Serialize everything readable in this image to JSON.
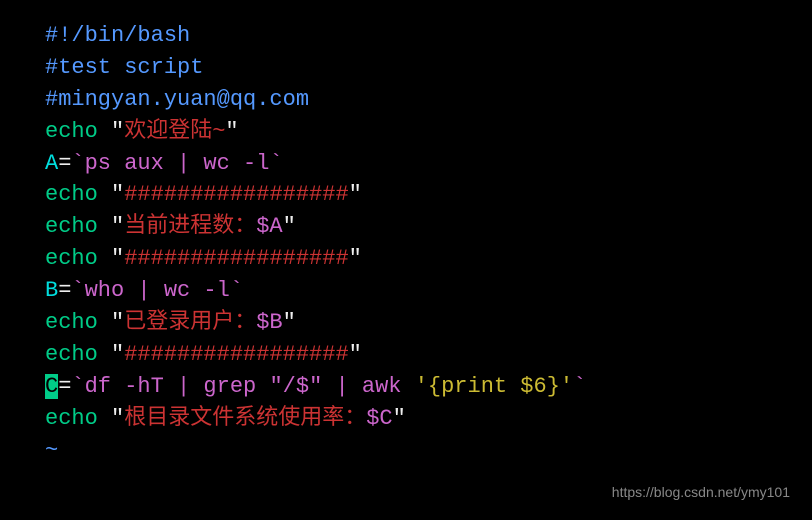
{
  "lines": {
    "l1": "#!/bin/bash",
    "l2": "#test script",
    "l3": "#mingyan.yuan@qq.com",
    "l4_echo": "echo",
    "l4_quote1": " \"",
    "l4_text": "欢迎登陆~",
    "l4_quote2": "\"",
    "l5_var": "A",
    "l5_eq": "=",
    "l5_tick1": "`",
    "l5_cmd": "ps aux | wc -l",
    "l5_tick2": "`",
    "l6_echo": "echo",
    "l6_quote1": " \"",
    "l6_text": "#################",
    "l6_quote2": "\"",
    "l7_echo": "echo",
    "l7_quote1": " \"",
    "l7_text": "当前进程数：",
    "l7_var": "$A",
    "l7_quote2": "\"",
    "l8_echo": "echo",
    "l8_quote1": " \"",
    "l8_text": "#################",
    "l8_quote2": "\"",
    "l9_var": "B",
    "l9_eq": "=",
    "l9_tick1": "`",
    "l9_cmd": "who | wc -l",
    "l9_tick2": "`",
    "l10_echo": "echo",
    "l10_quote1": " \"",
    "l10_text": "已登录用户：",
    "l10_var": "$B",
    "l10_quote2": "\"",
    "l11_echo": "echo",
    "l11_quote1": " \"",
    "l11_text": "#################",
    "l11_quote2": "\"",
    "l12_var": "C",
    "l12_eq": "=",
    "l12_tick1": "`",
    "l12_cmd1": "df -hT | grep ",
    "l12_str_open": "\"",
    "l12_str": "/$",
    "l12_str_close": "\"",
    "l12_cmd2": " | awk ",
    "l12_awk_open": "'",
    "l12_awk": "{print $6}",
    "l12_awk_close": "'",
    "l12_tick2": "`",
    "l13_echo": "echo",
    "l13_quote1": " \"",
    "l13_text": "根目录文件系统使用率：",
    "l13_var": "$C",
    "l13_quote2": "\"",
    "l14": "~"
  },
  "watermark": "https://blog.csdn.net/ymy101"
}
